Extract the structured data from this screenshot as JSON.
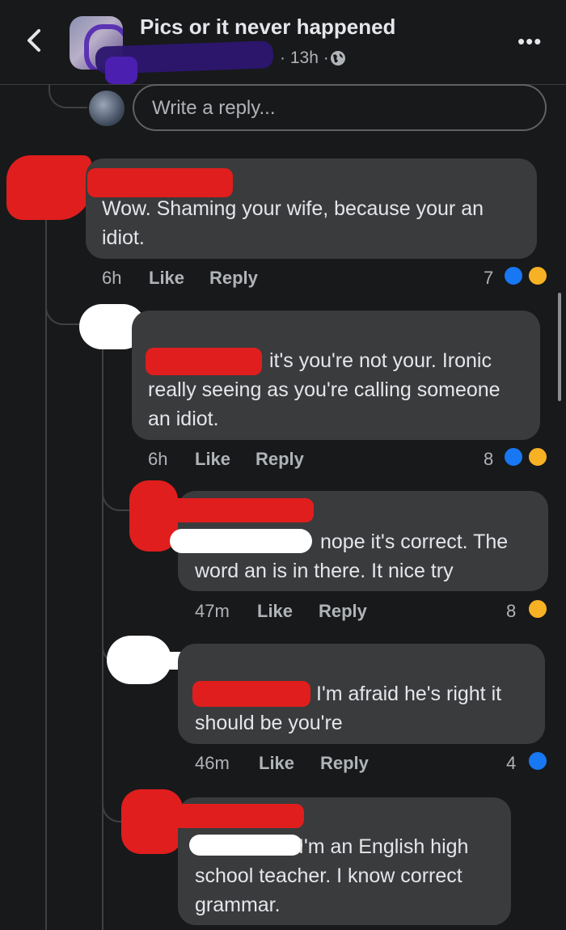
{
  "header": {
    "title": "Pics or it never happened",
    "time": "13h",
    "separator": "·"
  },
  "reply_box": {
    "placeholder": "Write a reply..."
  },
  "comments": [
    {
      "text": "Wow. Shaming your wife, because your an idiot.",
      "time": "6h",
      "like_label": "Like",
      "reply_label": "Reply",
      "reaction_count": "7",
      "reactions": [
        "like",
        "haha"
      ]
    },
    {
      "text": "it's you're not your. Ironic really seeing  as you're calling someone an idiot.",
      "time": "6h",
      "like_label": "Like",
      "reply_label": "Reply",
      "reaction_count": "8",
      "reactions": [
        "like",
        "haha"
      ]
    },
    {
      "text": "nope it's correct. The word an is in there.  It nice try",
      "time": "47m",
      "like_label": "Like",
      "reply_label": "Reply",
      "reaction_count": "8",
      "reactions": [
        "haha"
      ]
    },
    {
      "text": "I'm afraid he's right it should be you're",
      "time": "46m",
      "like_label": "Like",
      "reply_label": "Reply",
      "reaction_count": "4",
      "reactions": [
        "like"
      ]
    },
    {
      "text": "I'm an English high school teacher. I know correct grammar.",
      "time": "",
      "like_label": "",
      "reply_label": "",
      "reaction_count": "",
      "reactions": []
    }
  ],
  "colors": {
    "background": "#18191a",
    "bubble": "#3a3b3c",
    "like": "#1877f2",
    "haha": "#f7b125",
    "redaction_red": "#e01e1e",
    "redaction_purple": "#4b1fb0"
  },
  "icons": [
    "back-arrow-icon",
    "globe-icon",
    "more-options-icon",
    "like-reaction-icon",
    "haha-reaction-icon"
  ]
}
